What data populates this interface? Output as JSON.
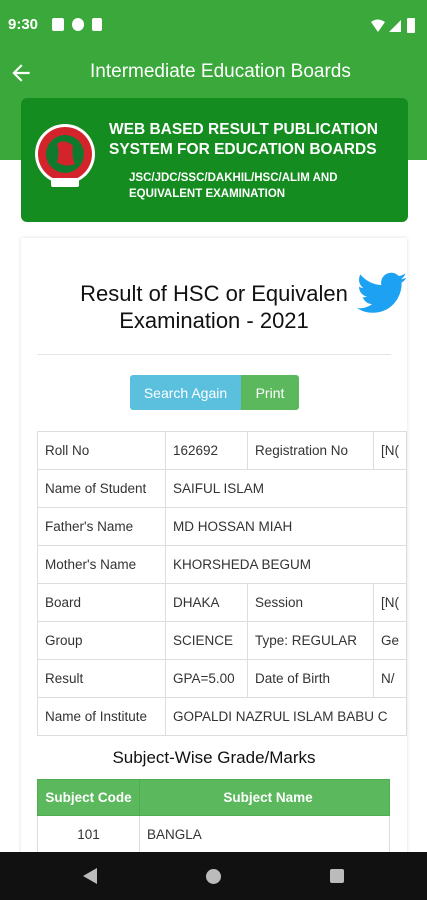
{
  "status": {
    "time": "9:30"
  },
  "toolbar": {
    "title": "Intermediate Education Boards",
    "back_icon": "arrow-left-icon"
  },
  "banner": {
    "heading": "WEB BASED RESULT PUBLICATION SYSTEM FOR EDUCATION BOARDS",
    "subheading": "JSC/JDC/SSC/DAKHIL/HSC/ALIM AND EQUIVALENT EXAMINATION",
    "background": "#148c1f"
  },
  "result": {
    "title_line1": "Result of HSC or Equivalen",
    "title_line2": "Examination - 2021"
  },
  "buttons": {
    "search_again": "Search Again",
    "print": "Print"
  },
  "info": {
    "roll_label": "Roll No",
    "roll_value": "162692",
    "reg_label": "Registration No",
    "reg_value": "[N(",
    "name_label": "Name of Student",
    "name_value": "SAIFUL ISLAM",
    "father_label": "Father's Name",
    "father_value": "MD HOSSAN MIAH",
    "mother_label": "Mother's Name",
    "mother_value": "KHORSHEDA BEGUM",
    "board_label": "Board",
    "board_value": "DHAKA",
    "session_label": "Session",
    "session_value": "[N(",
    "group_label": "Group",
    "group_value": "SCIENCE",
    "type_label": "Type: REGULAR",
    "type_value": "Ge",
    "result_label": "Result",
    "result_value": "GPA=5.00",
    "dob_label": "Date of Birth",
    "dob_value": "N/",
    "institute_label": "Name of Institute",
    "institute_value": "GOPALDI NAZRUL ISLAM BABU C"
  },
  "marks": {
    "title": "Subject-Wise Grade/Marks",
    "col_code": "Subject Code",
    "col_name": "Subject Name",
    "rows": [
      {
        "code": "101",
        "name": "BANGLA"
      }
    ]
  },
  "colors": {
    "appbar": "#3aa83a",
    "search_btn": "#5bc0de",
    "print_btn": "#5cb85c",
    "header_row": "#5cb85c"
  }
}
